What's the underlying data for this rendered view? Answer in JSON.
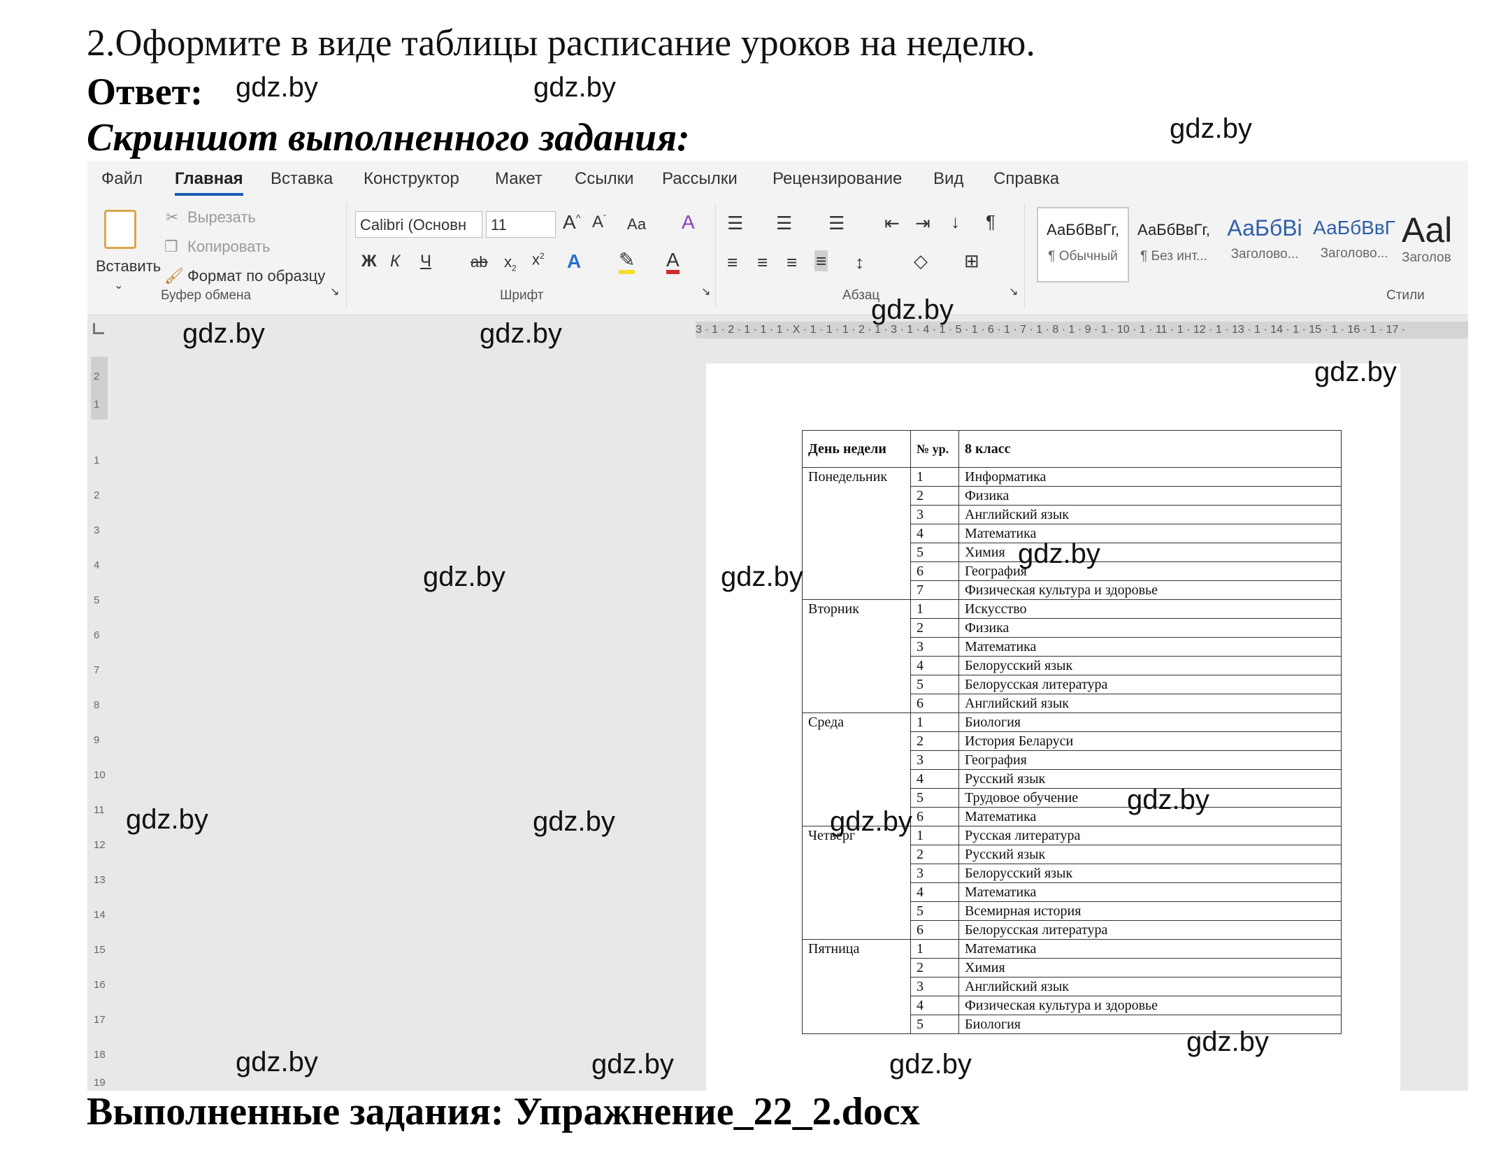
{
  "task": "2.Оформите в виде таблицы расписание уроков на неделю.",
  "answer_label": "Ответ:",
  "screenshot_label": "Скриншот выполненного задания:",
  "footer": "Выполненные задания: Упражнение_22_2.docx",
  "watermark": "gdz.by",
  "word": {
    "tabs": [
      "Файл",
      "Главная",
      "Вставка",
      "Конструктор",
      "Макет",
      "Ссылки",
      "Рассылки",
      "Рецензирование",
      "Вид",
      "Справка"
    ],
    "clipboard": {
      "paste": "Вставить",
      "cut": "Вырезать",
      "copy": "Копировать",
      "format_painter": "Формат по образцу",
      "group": "Буфер обмена"
    },
    "font": {
      "name": "Calibri (Основн",
      "size": "11",
      "case": "Аа",
      "bold": "Ж",
      "italic": "К",
      "underline": "Ч",
      "strike": "ab",
      "group": "Шрифт"
    },
    "paragraph_group": "Абзац",
    "styles_group": "Стили",
    "styles": [
      {
        "preview": "АаБбВвГг,",
        "name": "¶ Обычный"
      },
      {
        "preview": "АаБбВвГг,",
        "name": "¶ Без инт..."
      },
      {
        "preview": "АаБбВі",
        "name": "Заголово..."
      },
      {
        "preview": "АаБбВвГ",
        "name": "Заголово..."
      },
      {
        "preview": "Aal",
        "name": "Заголов"
      }
    ],
    "ruler": "3 · 1 · 2 · 1 · 1 · 1 · X · 1 · 1 · 1 · 2 · 1 · 3 · 1 · 4 · 1 · 5 · 1 · 6 · 1 · 7 · 1 · 8 · 1 · 9 · 1 · 10 · 1 · 11 · 1 · 12 · 1 · 13 · 1 · 14 · 1 · 15 · 1 · 16 · 1 · 17 ·"
  },
  "table": {
    "headers": [
      "День недели",
      "№ ур.",
      "8 класс"
    ],
    "days": [
      {
        "day": "Понедельник",
        "lessons": [
          "Информатика",
          "Физика",
          "Английский язык",
          "Математика",
          "Химия",
          "География",
          "Физическая культура и здоровье"
        ]
      },
      {
        "day": "Вторник",
        "lessons": [
          "Искусство",
          "Физика",
          "Математика",
          "Белорусский язык",
          "Белорусская литература",
          "Английский язык"
        ]
      },
      {
        "day": "Среда",
        "lessons": [
          "Биология",
          "История Беларуси",
          "География",
          "Русский язык",
          "Трудовое обучение",
          "Математика"
        ]
      },
      {
        "day": "Четверг",
        "lessons": [
          "Русская литература",
          "Русский язык",
          "Белорусский язык",
          "Математика",
          "Всемирная история",
          "Белорусская литература"
        ]
      },
      {
        "day": "Пятница",
        "lessons": [
          "Математика",
          "Химия",
          "Английский язык",
          "Физическая культура и здоровье",
          "Биология"
        ]
      }
    ]
  }
}
